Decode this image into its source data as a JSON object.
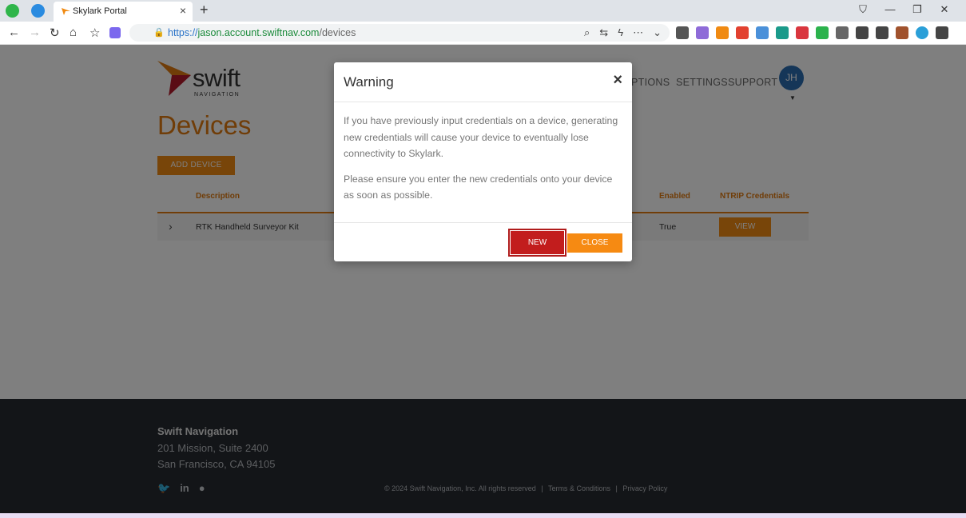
{
  "browser": {
    "tab_title": "Skylark Portal",
    "url_scheme": "https://",
    "url_host": "jason.account.swiftnav.com",
    "url_path": "/devices"
  },
  "header": {
    "logo_word": "swift",
    "logo_sub": "NAVIGATION",
    "nav": [
      "PTIONS",
      "SETTINGS",
      "SUPPORT"
    ],
    "avatar_initials": "JH"
  },
  "main": {
    "title": "Devices",
    "add_button": "ADD DEVICE",
    "columns": {
      "description": "Description",
      "enabled": "Enabled",
      "credentials": "NTRIP Credentials"
    },
    "rows": [
      {
        "description": "RTK Handheld Surveyor Kit",
        "enabled": "True",
        "action": "VIEW"
      }
    ]
  },
  "modal": {
    "title": "Warning",
    "body_1": "If you have previously input credentials on a device, generating new credentials will cause your device to eventually lose connectivity to Skylark.",
    "body_2": "Please ensure you enter the new credentials onto your device as soon as possible.",
    "new_label": "NEW",
    "close_label": "CLOSE"
  },
  "footer": {
    "company": "Swift Navigation",
    "address_line1": "201 Mission, Suite 2400",
    "address_line2": "San Francisco, CA 94105",
    "copyright": "© 2024 Swift Navigation, Inc. All rights reserved",
    "terms": "Terms & Conditions",
    "privacy": "Privacy Policy",
    "social_icons": [
      "twitter-icon",
      "linkedin-icon",
      "github-icon"
    ]
  },
  "colors": {
    "brand_orange": "#f08a12",
    "danger_red": "#c21d1d",
    "footer_bg": "#262a31"
  }
}
